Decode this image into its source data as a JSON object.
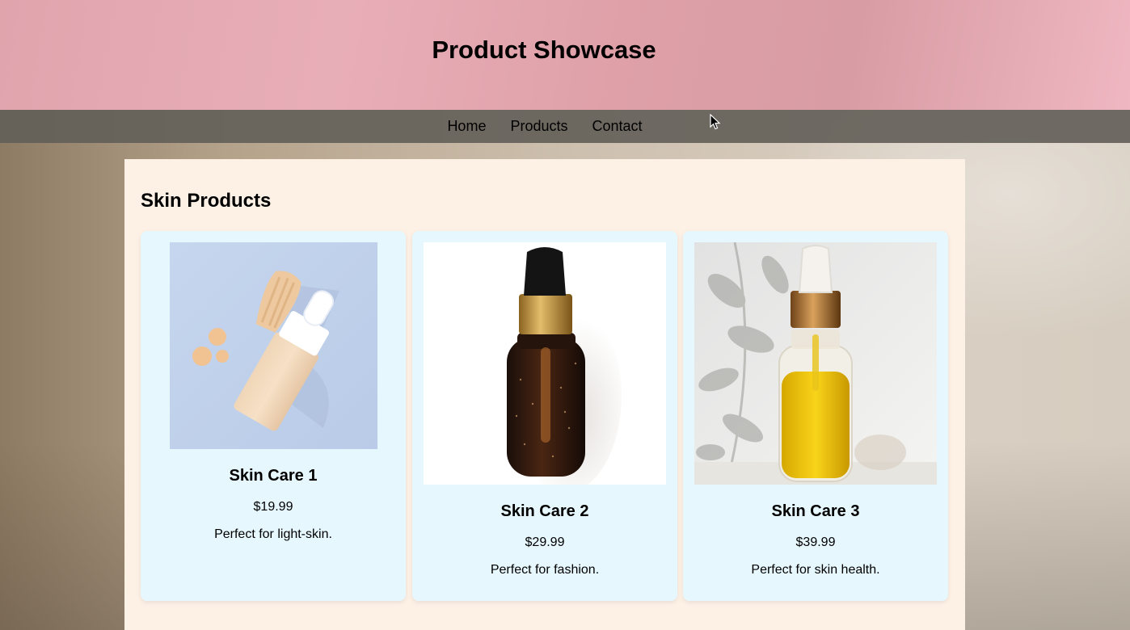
{
  "header": {
    "title": "Product Showcase"
  },
  "nav": {
    "items": [
      "Home",
      "Products",
      "Contact"
    ]
  },
  "section": {
    "title": "Skin Products"
  },
  "products": [
    {
      "name": "Skin Care 1",
      "price": "$19.99",
      "description": "Perfect for light-skin."
    },
    {
      "name": "Skin Care 2",
      "price": "$29.99",
      "description": "Perfect for fashion."
    },
    {
      "name": "Skin Care 3",
      "price": "$39.99",
      "description": "Perfect for skin health."
    }
  ],
  "colors": {
    "header_bg": "#e8aeb8",
    "nav_bg": "#625e58",
    "panel_bg": "#fdf1e6",
    "card_bg": "#e6f7fe"
  }
}
